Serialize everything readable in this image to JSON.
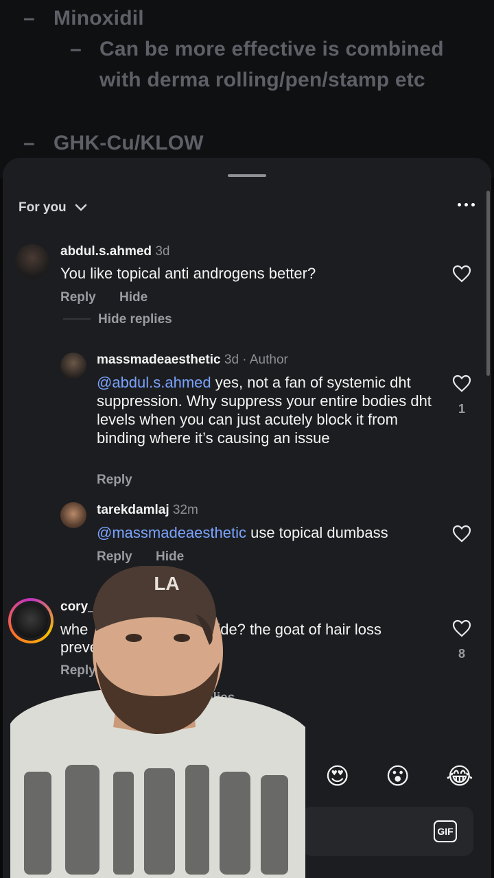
{
  "background_note": {
    "line1": "Minoxidil",
    "line2a": "Can be more effective is combined",
    "line2b": "with derma rolling/pen/stamp etc",
    "line3": "GHK-Cu/KLOW"
  },
  "sheet": {
    "filter_label": "For you"
  },
  "comments": [
    {
      "username": "abdul.s.ahmed",
      "meta": "3d",
      "text": "You like topical anti androgens better?",
      "reply_label": "Reply",
      "hide_label": "Hide",
      "hide_replies_label": "Hide replies"
    },
    {
      "username": "massmadeaesthetic",
      "meta": "3d · Author",
      "mention": "@abdul.s.ahmed",
      "text": " yes, not a fan of systemic dht suppression. Why suppress your entire bodies dht levels when you can just acutely block it from binding where it’s causing an issue",
      "reply_label": "Reply",
      "likes": "1"
    },
    {
      "username": "tarekdamlaj",
      "meta": "32m",
      "mention": "@massmadeaesthetic",
      "text": " use topical dumbass",
      "reply_label": "Reply",
      "hide_label": "Hide"
    },
    {
      "username": "cory_gi",
      "text_line1": "whe",
      "text_line1b": "ride? the goat of hair loss",
      "text_line2": "preve",
      "reply_label": "Reply",
      "likes": "8",
      "view_replies": "V",
      "view_replies_b": "plies"
    }
  ],
  "reactions": [
    "😍",
    "😮",
    "😂"
  ],
  "input": {
    "gif_label": "GIF"
  },
  "colors": {
    "sheet": "#1c1d20",
    "mention": "#7aa3ff",
    "muted": "#9a9ca1"
  }
}
